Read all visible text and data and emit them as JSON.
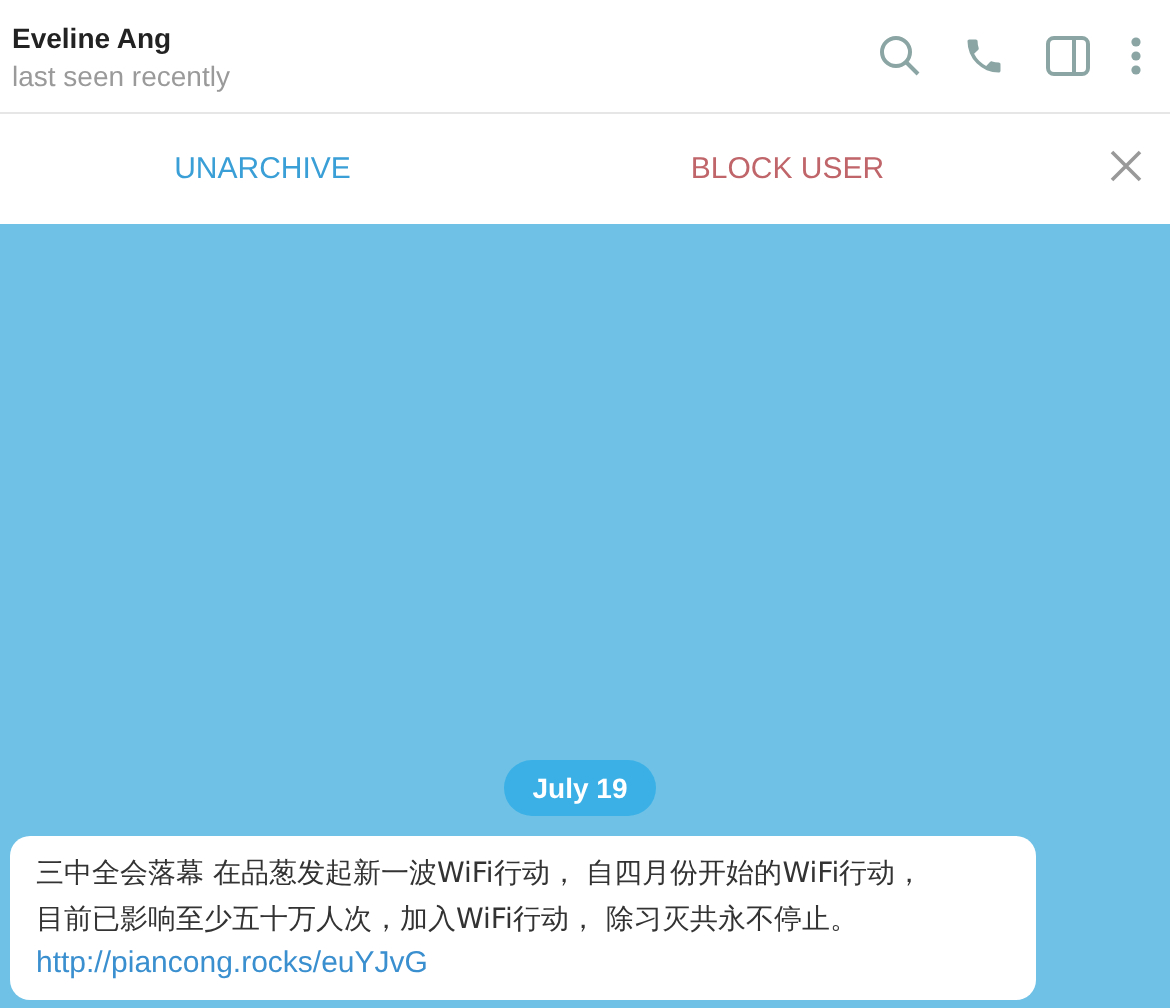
{
  "header": {
    "name": "Eveline Ang",
    "status": "last seen recently"
  },
  "actions": [
    {
      "kind": "primary",
      "label": "UNARCHIVE"
    },
    {
      "kind": "danger",
      "label": "BLOCK USER"
    }
  ],
  "chat": {
    "date": "July 19",
    "message": {
      "lines": [
        "三中全会落幕 在品葱发起新一波WiFi行动， 自四月份开始的WiFi行动，",
        "目前已影响至少五十万人次，加入WiFi行动， 除习灭共永不停止。"
      ],
      "link": "http://piancong.rocks/euYJvG"
    }
  }
}
